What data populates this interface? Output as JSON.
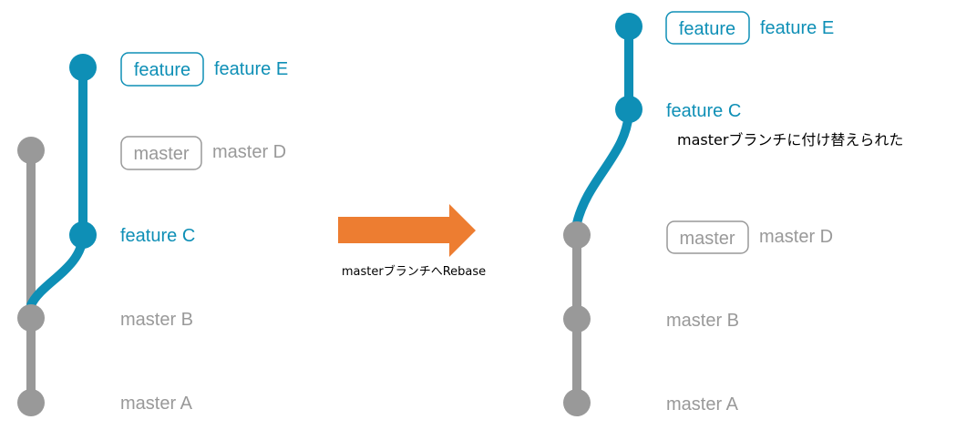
{
  "colors": {
    "feature": "#0e8fb6",
    "master": "#999999",
    "arrow": "#ed7d31",
    "note_text": "#000000"
  },
  "before": {
    "commits": {
      "feature_e": "feature E",
      "master_d": "master D",
      "feature_c": "feature C",
      "master_b": "master B",
      "master_a": "master A"
    },
    "tags": {
      "feature": "feature",
      "master": "master"
    }
  },
  "arrow": {
    "caption": "masterブランチへRebase"
  },
  "after": {
    "commits": {
      "feature_e": "feature E",
      "feature_c": "feature C",
      "master_d": "master D",
      "master_b": "master B",
      "master_a": "master A"
    },
    "tags": {
      "feature": "feature",
      "master": "master"
    },
    "note": "masterブランチに付け替えられた"
  }
}
